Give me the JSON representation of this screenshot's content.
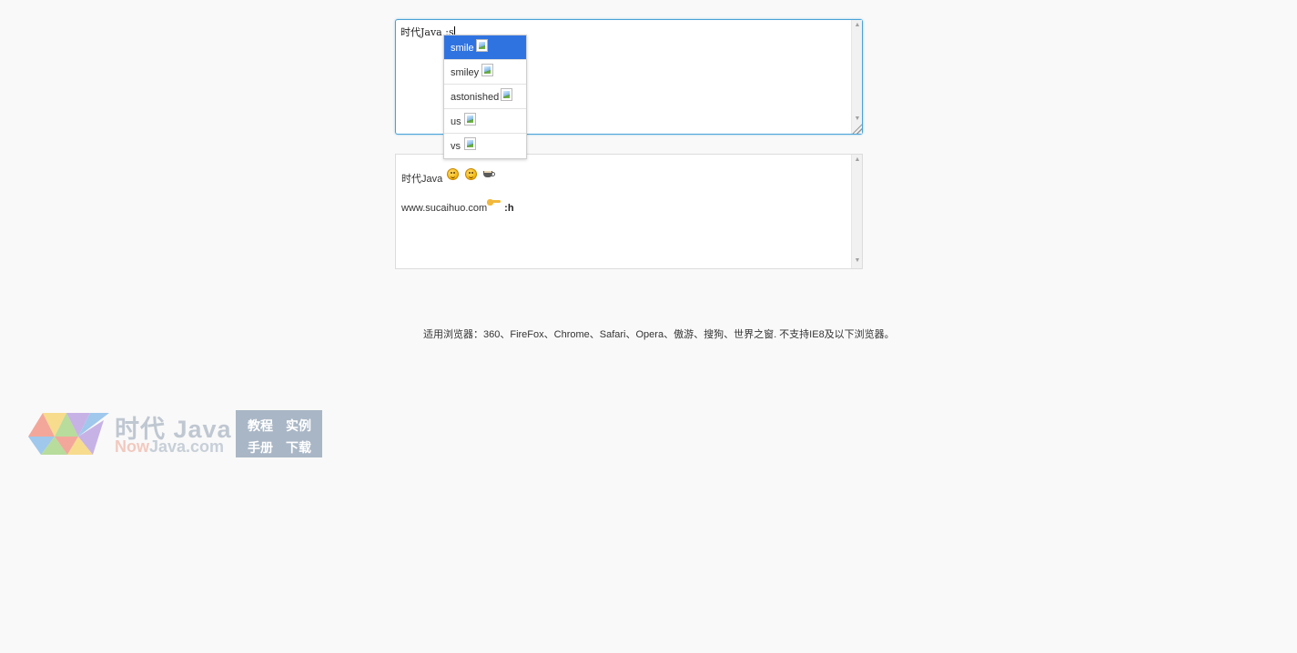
{
  "editor": {
    "value": "时代Java :s"
  },
  "autocomplete": {
    "items": [
      {
        "label": "smile",
        "active": true
      },
      {
        "label": "smiley",
        "active": false
      },
      {
        "label": "astonished",
        "active": false
      },
      {
        "label": "us",
        "active": false
      },
      {
        "label": "vs",
        "active": false
      }
    ]
  },
  "preview": {
    "line1_text": "时代Java",
    "line1_icons": [
      "smile-emoji-icon",
      "smiley-emoji-icon",
      "coffee-icon"
    ],
    "line2_text": "www.sucaihuo.com",
    "line2_icon": "point-right-icon",
    "line2_token": ":h"
  },
  "notice": {
    "text": "适用浏览器：360、FireFox、Chrome、Safari、Opera、傲游、搜狗、世界之窗. 不支持IE8及以下浏览器。"
  },
  "logo": {
    "zh": "时代 Java",
    "en_a": "Now",
    "en_b": "Java.com",
    "box": [
      "教程",
      "实例",
      "手册",
      "下载"
    ],
    "colors": {
      "triangle_red": "#f3a79a",
      "triangle_green": "#b7dc9c",
      "triangle_blue": "#9fc8ec",
      "triangle_yellow": "#f7dc8e",
      "triangle_purple": "#c7b2e6",
      "box_bg": "#a9b6c5"
    }
  }
}
